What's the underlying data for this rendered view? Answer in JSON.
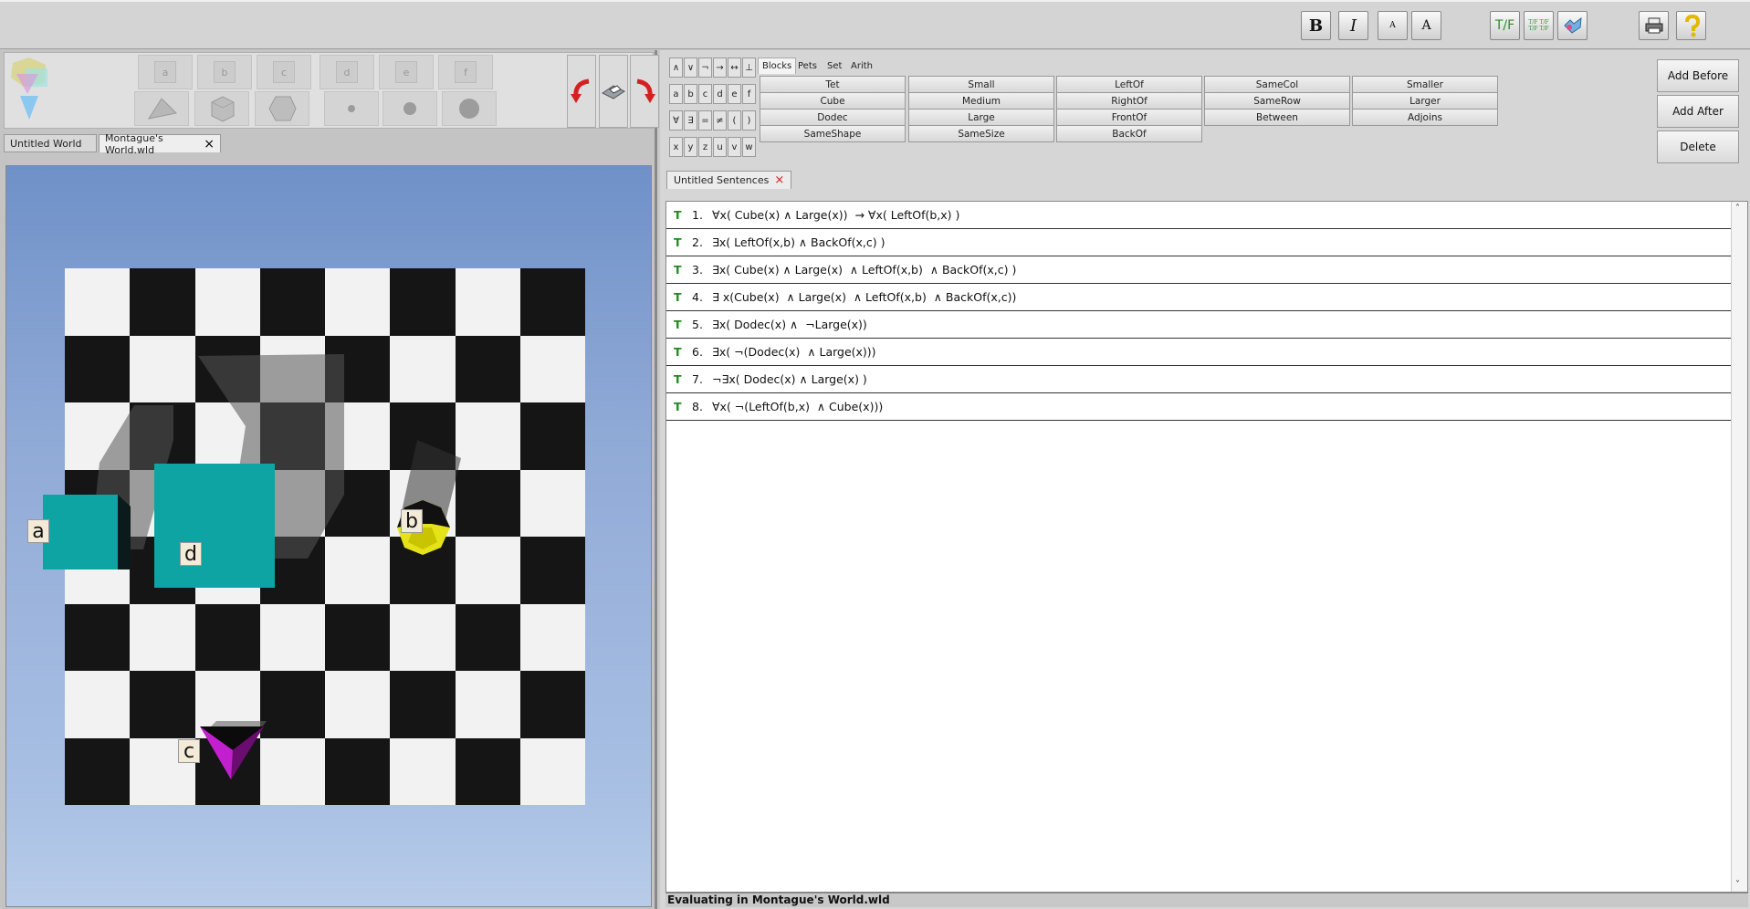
{
  "toolbar": {
    "bold": "B",
    "italic": "I",
    "font_small": "A",
    "font_large": "A",
    "tf": "T/F",
    "tf_multi": "T/F T/F T/F T/F"
  },
  "palette": {
    "letters": [
      "a",
      "b",
      "c",
      "d",
      "e",
      "f"
    ]
  },
  "world_tabs": [
    {
      "label": "Untitled World"
    },
    {
      "label": "Montague's World.wld",
      "close": "×"
    }
  ],
  "blocks": {
    "a": "a",
    "b": "b",
    "c": "c",
    "d": "d"
  },
  "symbols": {
    "row1": [
      "∧",
      "∨",
      "¬",
      "→",
      "↔",
      "⊥"
    ],
    "row2": [
      "a",
      "b",
      "c",
      "d",
      "e",
      "f"
    ],
    "row3": [
      "∀",
      "∃",
      "=",
      "≠",
      "(",
      ")"
    ],
    "row4": [
      "x",
      "y",
      "z",
      "u",
      "v",
      "w"
    ]
  },
  "predicate_tabs": [
    "Blocks",
    "Pets",
    "Set",
    "Arith"
  ],
  "predicates": {
    "col1": [
      "Tet",
      "Cube",
      "Dodec",
      "SameShape"
    ],
    "col2": [
      "Small",
      "Medium",
      "Large",
      "SameSize"
    ],
    "col3": [
      "LeftOf",
      "RightOf",
      "FrontOf",
      "BackOf"
    ],
    "col4": [
      "SameCol",
      "SameRow",
      "Between"
    ],
    "col5": [
      "Smaller",
      "Larger",
      "Adjoins"
    ]
  },
  "actions": {
    "add_before": "Add Before",
    "add_after": "Add After",
    "delete": "Delete"
  },
  "sentence_tab": {
    "label": "Untitled Sentences",
    "close": "×"
  },
  "sentences": [
    {
      "value": "T",
      "num": "1.",
      "text": "∀x( Cube(x) ∧ Large(x))  → ∀x( LeftOf(b,x) )"
    },
    {
      "value": "T",
      "num": "2.",
      "text": "∃x( LeftOf(x,b) ∧ BackOf(x,c) )"
    },
    {
      "value": "T",
      "num": "3.",
      "text": "∃x( Cube(x) ∧ Large(x)  ∧ LeftOf(x,b)  ∧ BackOf(x,c) )"
    },
    {
      "value": "T",
      "num": "4.",
      "text": "∃ x(Cube(x)  ∧ Large(x)  ∧ LeftOf(x,b)  ∧ BackOf(x,c))"
    },
    {
      "value": "T",
      "num": "5.",
      "text": "∃x( Dodec(x) ∧  ¬Large(x))"
    },
    {
      "value": "T",
      "num": "6.",
      "text": "∃x( ¬(Dodec(x)  ∧ Large(x)))"
    },
    {
      "value": "T",
      "num": "7.",
      "text": "¬∃x( Dodec(x) ∧ Large(x) )"
    },
    {
      "value": "T",
      "num": "8.",
      "text": "∀x( ¬(LeftOf(b,x)  ∧ Cube(x)))"
    }
  ],
  "status": "Evaluating in Montague's World.wld",
  "colors": {
    "true": "#1f8a1f",
    "cube": "#0fa4a4",
    "tet": "#c21fcf",
    "dodec": "#e6e21a"
  }
}
